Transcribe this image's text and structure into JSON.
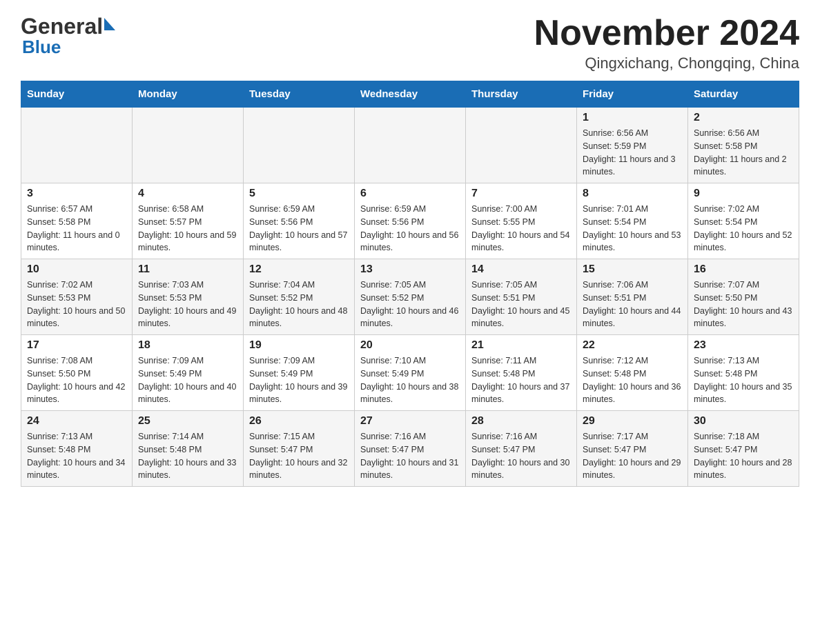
{
  "header": {
    "month_title": "November 2024",
    "location": "Qingxichang, Chongqing, China",
    "logo_top": "General",
    "logo_bottom": "Blue"
  },
  "days_of_week": [
    "Sunday",
    "Monday",
    "Tuesday",
    "Wednesday",
    "Thursday",
    "Friday",
    "Saturday"
  ],
  "weeks": [
    [
      {
        "day": "",
        "info": ""
      },
      {
        "day": "",
        "info": ""
      },
      {
        "day": "",
        "info": ""
      },
      {
        "day": "",
        "info": ""
      },
      {
        "day": "",
        "info": ""
      },
      {
        "day": "1",
        "info": "Sunrise: 6:56 AM\nSunset: 5:59 PM\nDaylight: 11 hours and 3 minutes."
      },
      {
        "day": "2",
        "info": "Sunrise: 6:56 AM\nSunset: 5:58 PM\nDaylight: 11 hours and 2 minutes."
      }
    ],
    [
      {
        "day": "3",
        "info": "Sunrise: 6:57 AM\nSunset: 5:58 PM\nDaylight: 11 hours and 0 minutes."
      },
      {
        "day": "4",
        "info": "Sunrise: 6:58 AM\nSunset: 5:57 PM\nDaylight: 10 hours and 59 minutes."
      },
      {
        "day": "5",
        "info": "Sunrise: 6:59 AM\nSunset: 5:56 PM\nDaylight: 10 hours and 57 minutes."
      },
      {
        "day": "6",
        "info": "Sunrise: 6:59 AM\nSunset: 5:56 PM\nDaylight: 10 hours and 56 minutes."
      },
      {
        "day": "7",
        "info": "Sunrise: 7:00 AM\nSunset: 5:55 PM\nDaylight: 10 hours and 54 minutes."
      },
      {
        "day": "8",
        "info": "Sunrise: 7:01 AM\nSunset: 5:54 PM\nDaylight: 10 hours and 53 minutes."
      },
      {
        "day": "9",
        "info": "Sunrise: 7:02 AM\nSunset: 5:54 PM\nDaylight: 10 hours and 52 minutes."
      }
    ],
    [
      {
        "day": "10",
        "info": "Sunrise: 7:02 AM\nSunset: 5:53 PM\nDaylight: 10 hours and 50 minutes."
      },
      {
        "day": "11",
        "info": "Sunrise: 7:03 AM\nSunset: 5:53 PM\nDaylight: 10 hours and 49 minutes."
      },
      {
        "day": "12",
        "info": "Sunrise: 7:04 AM\nSunset: 5:52 PM\nDaylight: 10 hours and 48 minutes."
      },
      {
        "day": "13",
        "info": "Sunrise: 7:05 AM\nSunset: 5:52 PM\nDaylight: 10 hours and 46 minutes."
      },
      {
        "day": "14",
        "info": "Sunrise: 7:05 AM\nSunset: 5:51 PM\nDaylight: 10 hours and 45 minutes."
      },
      {
        "day": "15",
        "info": "Sunrise: 7:06 AM\nSunset: 5:51 PM\nDaylight: 10 hours and 44 minutes."
      },
      {
        "day": "16",
        "info": "Sunrise: 7:07 AM\nSunset: 5:50 PM\nDaylight: 10 hours and 43 minutes."
      }
    ],
    [
      {
        "day": "17",
        "info": "Sunrise: 7:08 AM\nSunset: 5:50 PM\nDaylight: 10 hours and 42 minutes."
      },
      {
        "day": "18",
        "info": "Sunrise: 7:09 AM\nSunset: 5:49 PM\nDaylight: 10 hours and 40 minutes."
      },
      {
        "day": "19",
        "info": "Sunrise: 7:09 AM\nSunset: 5:49 PM\nDaylight: 10 hours and 39 minutes."
      },
      {
        "day": "20",
        "info": "Sunrise: 7:10 AM\nSunset: 5:49 PM\nDaylight: 10 hours and 38 minutes."
      },
      {
        "day": "21",
        "info": "Sunrise: 7:11 AM\nSunset: 5:48 PM\nDaylight: 10 hours and 37 minutes."
      },
      {
        "day": "22",
        "info": "Sunrise: 7:12 AM\nSunset: 5:48 PM\nDaylight: 10 hours and 36 minutes."
      },
      {
        "day": "23",
        "info": "Sunrise: 7:13 AM\nSunset: 5:48 PM\nDaylight: 10 hours and 35 minutes."
      }
    ],
    [
      {
        "day": "24",
        "info": "Sunrise: 7:13 AM\nSunset: 5:48 PM\nDaylight: 10 hours and 34 minutes."
      },
      {
        "day": "25",
        "info": "Sunrise: 7:14 AM\nSunset: 5:48 PM\nDaylight: 10 hours and 33 minutes."
      },
      {
        "day": "26",
        "info": "Sunrise: 7:15 AM\nSunset: 5:47 PM\nDaylight: 10 hours and 32 minutes."
      },
      {
        "day": "27",
        "info": "Sunrise: 7:16 AM\nSunset: 5:47 PM\nDaylight: 10 hours and 31 minutes."
      },
      {
        "day": "28",
        "info": "Sunrise: 7:16 AM\nSunset: 5:47 PM\nDaylight: 10 hours and 30 minutes."
      },
      {
        "day": "29",
        "info": "Sunrise: 7:17 AM\nSunset: 5:47 PM\nDaylight: 10 hours and 29 minutes."
      },
      {
        "day": "30",
        "info": "Sunrise: 7:18 AM\nSunset: 5:47 PM\nDaylight: 10 hours and 28 minutes."
      }
    ]
  ]
}
